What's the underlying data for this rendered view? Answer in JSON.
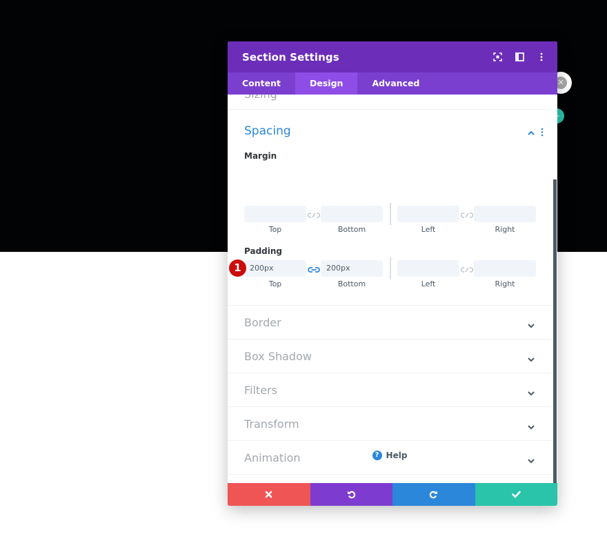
{
  "modal": {
    "title": "Section Settings",
    "header_icons": [
      "focus-mode-icon",
      "split-view-icon",
      "more-options-icon"
    ],
    "tabs": [
      {
        "label": "Content",
        "active": false
      },
      {
        "label": "Design",
        "active": true
      },
      {
        "label": "Advanced",
        "active": false
      }
    ],
    "previous_section": "Sizing",
    "spacing": {
      "title": "Spacing",
      "expanded": true,
      "margin": {
        "label": "Margin",
        "fields": [
          {
            "name": "Top",
            "value": ""
          },
          {
            "name": "Bottom",
            "value": ""
          },
          {
            "name": "Left",
            "value": ""
          },
          {
            "name": "Right",
            "value": ""
          }
        ],
        "top_bottom_linked": false,
        "left_right_linked": false
      },
      "padding": {
        "label": "Padding",
        "badge": "1",
        "fields": [
          {
            "name": "Top",
            "value": "200px"
          },
          {
            "name": "Bottom",
            "value": "200px"
          },
          {
            "name": "Left",
            "value": ""
          },
          {
            "name": "Right",
            "value": ""
          }
        ],
        "top_bottom_linked": true,
        "left_right_linked": false
      }
    },
    "sections": [
      {
        "title": "Border"
      },
      {
        "title": "Box Shadow"
      },
      {
        "title": "Filters"
      },
      {
        "title": "Transform"
      },
      {
        "title": "Animation"
      }
    ],
    "help_label": "Help",
    "footer": {
      "cancel": "cancel",
      "undo": "undo",
      "redo": "redo",
      "save": "save"
    }
  },
  "colors": {
    "header": "#6c2eb9",
    "tabs": "#7b3fd0",
    "tab_active": "#8e4de6",
    "accent_blue": "#2b87da",
    "cancel": "#ef5555",
    "undo": "#7e3bd0",
    "redo": "#2b87da",
    "save": "#29c4a9",
    "badge": "#cc0b0b"
  }
}
